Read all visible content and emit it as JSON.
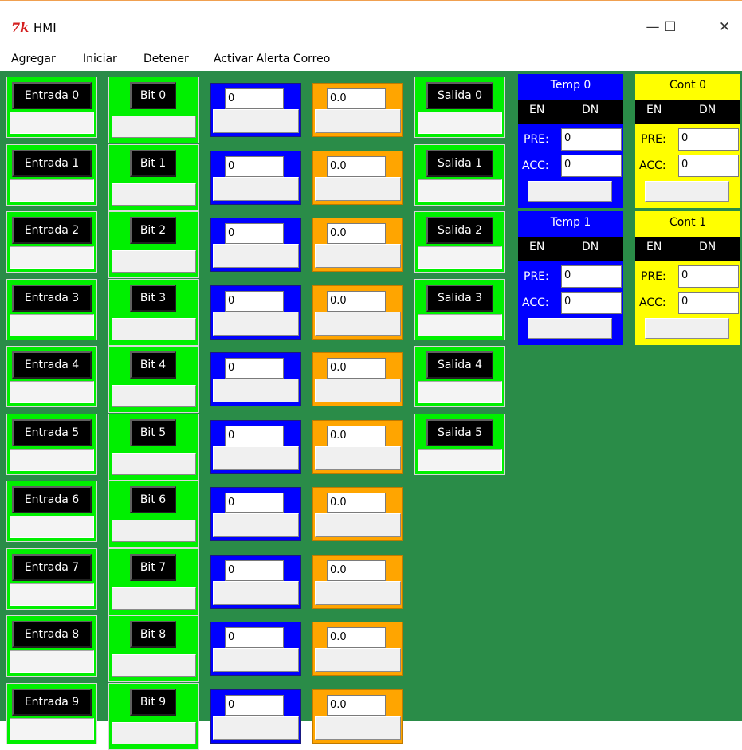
{
  "window": {
    "title": "HMI",
    "app_icon": "tk-feather-icon",
    "minimize": "—",
    "maximize": "☐",
    "close": "✕"
  },
  "menu": {
    "items": [
      "Agregar",
      "Iniciar",
      "Detener",
      "Activar Alerta Correo"
    ]
  },
  "colors": {
    "background": "#2a8c48",
    "green": "#00f000",
    "blue": "#0000ff",
    "orange": "#ffa500",
    "yellow": "#ffff00"
  },
  "inputs": [
    "Entrada 0",
    "Entrada 1",
    "Entrada 2",
    "Entrada 3",
    "Entrada 4",
    "Entrada 5",
    "Entrada 6",
    "Entrada 7",
    "Entrada 8",
    "Entrada 9"
  ],
  "bits": [
    "Bit 0",
    "Bit 1",
    "Bit 2",
    "Bit 3",
    "Bit 4",
    "Bit 5",
    "Bit 6",
    "Bit 7",
    "Bit 8",
    "Bit 9"
  ],
  "integers": [
    "0",
    "0",
    "0",
    "0",
    "0",
    "0",
    "0",
    "0",
    "0",
    "0"
  ],
  "floats": [
    "0.0",
    "0.0",
    "0.0",
    "0.0",
    "0.0",
    "0.0",
    "0.0",
    "0.0",
    "0.0",
    "0.0"
  ],
  "outputs": [
    "Salida 0",
    "Salida 1",
    "Salida 2",
    "Salida 3",
    "Salida 4",
    "Salida 5"
  ],
  "timers": [
    {
      "title": "Temp 0",
      "en": "EN",
      "dn": "DN",
      "pre_label": "PRE:",
      "pre": "0",
      "acc_label": "ACC:",
      "acc": "0"
    },
    {
      "title": "Temp 1",
      "en": "EN",
      "dn": "DN",
      "pre_label": "PRE:",
      "pre": "0",
      "acc_label": "ACC:",
      "acc": "0"
    }
  ],
  "counters": [
    {
      "title": "Cont 0",
      "en": "EN",
      "dn": "DN",
      "pre_label": "PRE:",
      "pre": "0",
      "acc_label": "ACC:",
      "acc": "0"
    },
    {
      "title": "Cont 1",
      "en": "EN",
      "dn": "DN",
      "pre_label": "PRE:",
      "pre": "0",
      "acc_label": "ACC:",
      "acc": "0"
    }
  ]
}
